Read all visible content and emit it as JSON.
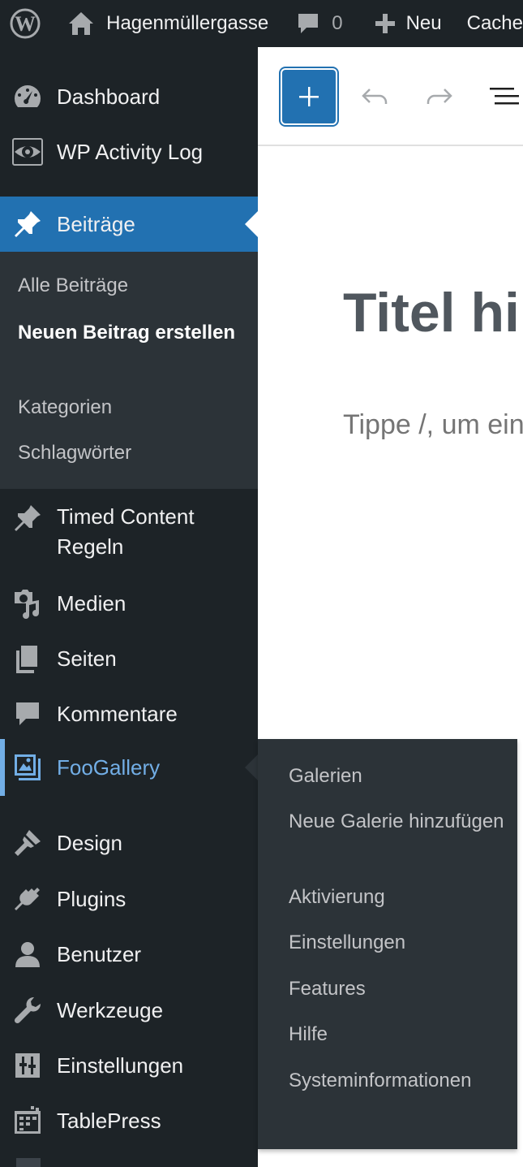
{
  "adminbar": {
    "site_name": "Hagenmüllergasse",
    "comments_count": "0",
    "new_label": "Neu",
    "cache_label": "Cache"
  },
  "sidebar": {
    "dashboard": "Dashboard",
    "activity_log": "WP Activity Log",
    "posts": "Beiträge",
    "posts_submenu": [
      "Alle Beiträge",
      "Neuen Beitrag erstellen",
      "Kategorien",
      "Schlagwörter"
    ],
    "timed_content": "Timed Content Regeln",
    "media": "Medien",
    "pages": "Seiten",
    "comments": "Kommentare",
    "foogallery": "FooGallery",
    "design": "Design",
    "plugins": "Plugins",
    "users": "Benutzer",
    "tools": "Werkzeuge",
    "settings": "Einstellungen",
    "tablepress": "TablePress"
  },
  "flyout": {
    "items": [
      "Galerien",
      "Neue Galerie hinzufügen",
      "Aktivierung",
      "Einstellungen",
      "Features",
      "Hilfe",
      "Systeminformationen"
    ]
  },
  "editor": {
    "title_placeholder": "Titel hinzufügen",
    "block_placeholder": "Tippe /, um einen Block auszuwählen"
  },
  "colors": {
    "admin_dark": "#1d2327",
    "submenu_bg": "#2c3338",
    "accent_blue": "#2271b1",
    "hover_blue": "#72aee6"
  },
  "icons": {
    "wordpress": "wordpress-logo-icon",
    "home": "home-icon",
    "comment": "comment-bubble-icon",
    "plus": "plus-icon",
    "dashboard": "dashboard-gauge-icon",
    "activity_log": "eye-icon",
    "posts": "pushpin-icon",
    "media": "media-camera-music-icon",
    "pages": "pages-icon",
    "comments": "comment-bubble-icon",
    "foogallery": "gallery-icon",
    "design": "paintbrush-icon",
    "plugins": "plug-icon",
    "users": "user-icon",
    "tools": "wrench-icon",
    "settings": "sliders-icon",
    "tablepress": "table-icon"
  }
}
